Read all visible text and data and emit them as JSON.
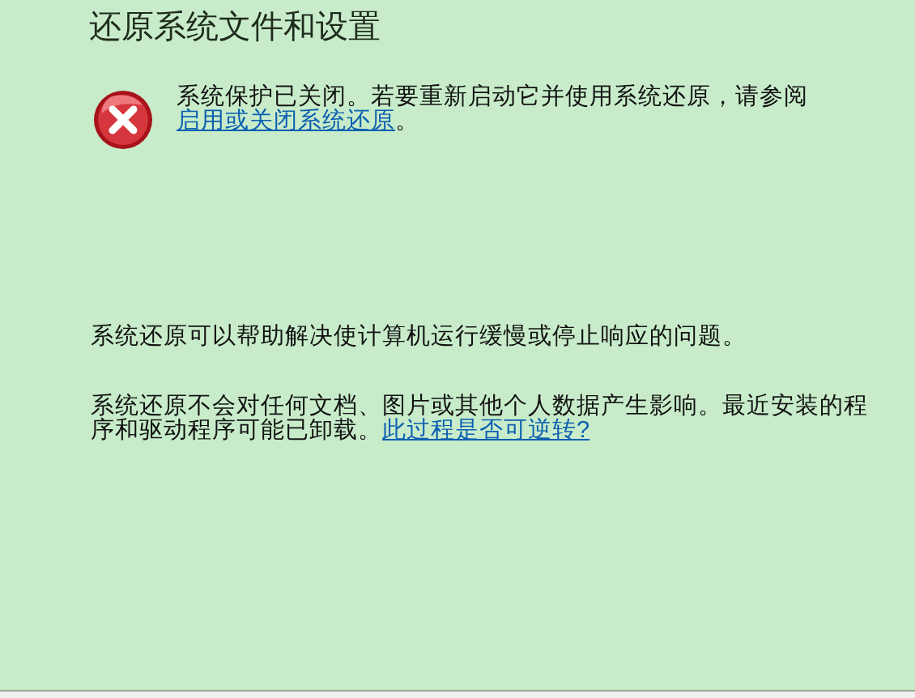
{
  "title": "还原系统文件和设置",
  "notice": {
    "kind": "error",
    "text": "系统保护已关闭。若要重新启动它并使用系统还原，请参阅",
    "link": "启用或关闭系统还原",
    "after": "。"
  },
  "paragraphs": [
    {
      "text": "系统还原可以帮助解决使计算机运行缓慢或停止响应的问题。"
    },
    {
      "text": "系统还原不会对任何文档、图片或其他个人数据产生影响。最近安装的程序和驱动程序可能已卸载。",
      "link": "此过程是否可逆转?"
    }
  ]
}
